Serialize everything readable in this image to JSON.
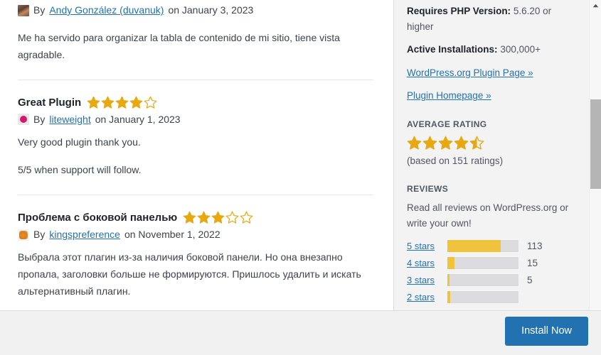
{
  "window": {
    "title": "Plugin Details"
  },
  "content": {
    "reviews": [
      {
        "title": "",
        "rating": 0,
        "by_label": "By",
        "author": "Andy González (duvanuk)",
        "on_label": "on",
        "date": "January 3, 2023",
        "avatar": "avatar-photo-icon",
        "paragraphs": [
          "Me ha servido para organizar la tabla de contenido de mi sitio, tiene vista agradable."
        ]
      },
      {
        "title": "Great Plugin",
        "rating": 4,
        "by_label": "By",
        "author": "liteweight",
        "on_label": "on",
        "date": "January 1, 2023",
        "avatar": "avatar-dot-icon",
        "paragraphs": [
          "Very good plugin thank you.",
          "5/5 when support will follow."
        ]
      },
      {
        "title": "Проблема с боковой панелью",
        "rating": 3,
        "by_label": "By",
        "author": "kingspreference",
        "on_label": "on",
        "date": "November 1, 2022",
        "avatar": "avatar-blob-icon",
        "paragraphs": [
          "Выбрала этот плагин из-за наличия боковой панели. Но она внезапно пропала, заголовки больше не формируются. Пришлось удалить и искать альтернативный плагин."
        ]
      }
    ]
  },
  "sidebar": {
    "requires_php_label": "Requires PHP Version:",
    "requires_php_value": "5.6.20 or higher",
    "active_installs_label": "Active Installations:",
    "active_installs_value": "300,000+",
    "links": [
      "WordPress.org Plugin Page »",
      "Plugin Homepage »"
    ],
    "average_rating_heading": "AVERAGE RATING",
    "average_rating_value": 4.5,
    "ratings_basis": "(based on 151 ratings)",
    "reviews_heading": "REVIEWS",
    "reviews_intro": "Read all reviews on WordPress.org or write your own!",
    "rating_bars": [
      {
        "label": "5 stars",
        "count": "113",
        "percent": 75
      },
      {
        "label": "4 stars",
        "count": "15",
        "percent": 10
      },
      {
        "label": "3 stars",
        "count": "5",
        "percent": 3
      },
      {
        "label": "2 stars",
        "count": "",
        "percent": 4
      }
    ]
  },
  "footer": {
    "install_button_label": "Install Now"
  },
  "scrollbar": {
    "up_arrow_icon": "chevron-up-icon"
  },
  "colors": {
    "star_gold": "#e8a812",
    "bar_fill": "#f0c33c",
    "bar_track": "#dcdcde",
    "link_blue": "#2271b1",
    "button_blue": "#2271b1",
    "sidebar_bg": "#f3f3f4",
    "footer_bg": "#f1f1f1"
  }
}
